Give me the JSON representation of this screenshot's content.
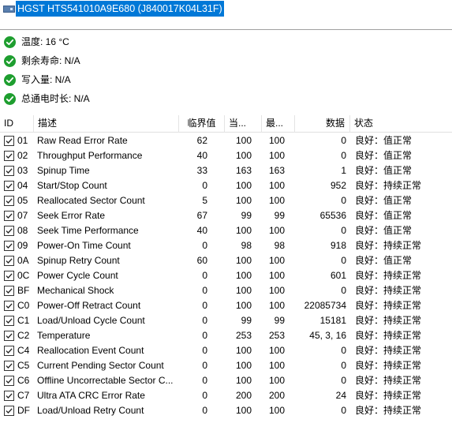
{
  "drive": {
    "title": "HGST HTS541010A9E680 (J840017K04L31F)"
  },
  "status": [
    {
      "label": "温度: 16 °C",
      "icon": "ok-check-icon"
    },
    {
      "label": "剩余寿命: N/A",
      "icon": "ok-check-icon"
    },
    {
      "label": "写入量: N/A",
      "icon": "ok-check-icon"
    },
    {
      "label": "总通电时长: N/A",
      "icon": "ok-check-icon"
    }
  ],
  "table": {
    "headers": {
      "id": "ID",
      "desc": "描述",
      "threshold": "临界值",
      "current": "当...",
      "worst": "最...",
      "data": "数据",
      "status": "状态"
    },
    "rows": [
      {
        "checked": true,
        "id": "01",
        "desc": "Raw Read Error Rate",
        "threshold": "62",
        "current": "100",
        "worst": "100",
        "data": "0",
        "status": "良好：值正常"
      },
      {
        "checked": true,
        "id": "02",
        "desc": "Throughput Performance",
        "threshold": "40",
        "current": "100",
        "worst": "100",
        "data": "0",
        "status": "良好：值正常"
      },
      {
        "checked": true,
        "id": "03",
        "desc": "Spinup Time",
        "threshold": "33",
        "current": "163",
        "worst": "163",
        "data": "1",
        "status": "良好：值正常"
      },
      {
        "checked": true,
        "id": "04",
        "desc": "Start/Stop Count",
        "threshold": "0",
        "current": "100",
        "worst": "100",
        "data": "952",
        "status": "良好：持续正常"
      },
      {
        "checked": true,
        "id": "05",
        "desc": "Reallocated Sector Count",
        "threshold": "5",
        "current": "100",
        "worst": "100",
        "data": "0",
        "status": "良好：值正常"
      },
      {
        "checked": true,
        "id": "07",
        "desc": "Seek Error Rate",
        "threshold": "67",
        "current": "99",
        "worst": "99",
        "data": "65536",
        "status": "良好：值正常"
      },
      {
        "checked": true,
        "id": "08",
        "desc": "Seek Time Performance",
        "threshold": "40",
        "current": "100",
        "worst": "100",
        "data": "0",
        "status": "良好：值正常"
      },
      {
        "checked": true,
        "id": "09",
        "desc": "Power-On Time Count",
        "threshold": "0",
        "current": "98",
        "worst": "98",
        "data": "918",
        "status": "良好：持续正常"
      },
      {
        "checked": true,
        "id": "0A",
        "desc": "Spinup Retry Count",
        "threshold": "60",
        "current": "100",
        "worst": "100",
        "data": "0",
        "status": "良好：值正常"
      },
      {
        "checked": true,
        "id": "0C",
        "desc": "Power Cycle Count",
        "threshold": "0",
        "current": "100",
        "worst": "100",
        "data": "601",
        "status": "良好：持续正常"
      },
      {
        "checked": true,
        "id": "BF",
        "desc": "Mechanical Shock",
        "threshold": "0",
        "current": "100",
        "worst": "100",
        "data": "0",
        "status": "良好：持续正常"
      },
      {
        "checked": true,
        "id": "C0",
        "desc": "Power-Off Retract Count",
        "threshold": "0",
        "current": "100",
        "worst": "100",
        "data": "22085734",
        "status": "良好：持续正常"
      },
      {
        "checked": true,
        "id": "C1",
        "desc": "Load/Unload Cycle Count",
        "threshold": "0",
        "current": "99",
        "worst": "99",
        "data": "15181",
        "status": "良好：持续正常"
      },
      {
        "checked": true,
        "id": "C2",
        "desc": "Temperature",
        "threshold": "0",
        "current": "253",
        "worst": "253",
        "data": "45, 3, 16",
        "status": "良好：持续正常"
      },
      {
        "checked": true,
        "id": "C4",
        "desc": "Reallocation Event Count",
        "threshold": "0",
        "current": "100",
        "worst": "100",
        "data": "0",
        "status": "良好：持续正常"
      },
      {
        "checked": true,
        "id": "C5",
        "desc": "Current Pending Sector Count",
        "threshold": "0",
        "current": "100",
        "worst": "100",
        "data": "0",
        "status": "良好：持续正常"
      },
      {
        "checked": true,
        "id": "C6",
        "desc": "Offline Uncorrectable Sector C...",
        "threshold": "0",
        "current": "100",
        "worst": "100",
        "data": "0",
        "status": "良好：持续正常"
      },
      {
        "checked": true,
        "id": "C7",
        "desc": "Ultra ATA CRC Error Rate",
        "threshold": "0",
        "current": "200",
        "worst": "200",
        "data": "24",
        "status": "良好：持续正常"
      },
      {
        "checked": true,
        "id": "DF",
        "desc": "Load/Unload Retry Count",
        "threshold": "0",
        "current": "100",
        "worst": "100",
        "data": "0",
        "status": "良好：持续正常"
      }
    ]
  },
  "colors": {
    "selection": "#0078d7",
    "ok": "#1e9e2f"
  }
}
